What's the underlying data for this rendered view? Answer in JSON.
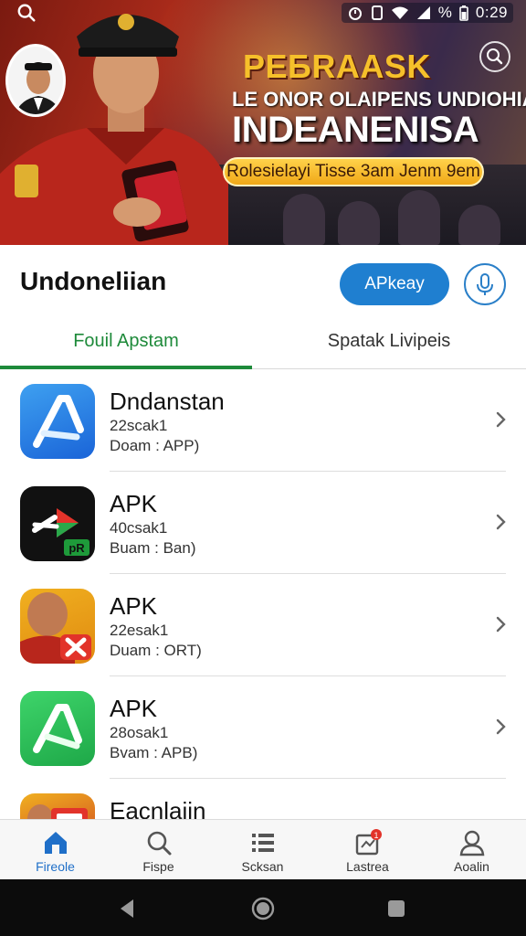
{
  "status_bar": {
    "time": "0:29",
    "battery": "%"
  },
  "banner": {
    "title": "PEБRAASK",
    "subtitle": "LE ONOR OLAIPENS UNDIOHIAN",
    "heading": "INDEANENISA",
    "pill_text": "Rolesielayi Tisse 3am Jenm 9em"
  },
  "header": {
    "title": "Undoneliian",
    "primary_button": "APkeay"
  },
  "tabs": [
    {
      "label": "Fouil Apstam"
    },
    {
      "label": "Spatak Livipeis"
    }
  ],
  "list": [
    {
      "name": "Dndanstan",
      "size": "22scak1",
      "meta": "Doam : APP)"
    },
    {
      "name": "APK",
      "size": "40csak1",
      "meta": "Buam : Ban)"
    },
    {
      "name": "APK",
      "size": "22esak1",
      "meta": "Duam : ORT)"
    },
    {
      "name": "APK",
      "size": "28osak1",
      "meta": "Bvam : APB)"
    },
    {
      "name": "Eacnlaiin",
      "size": "",
      "meta": ""
    }
  ],
  "bottom_nav": [
    {
      "label": "Fireole",
      "icon": "home-icon"
    },
    {
      "label": "Fispe",
      "icon": "search-icon"
    },
    {
      "label": "Scksan",
      "icon": "list-icon"
    },
    {
      "label": "Lastrea",
      "icon": "notification-icon",
      "badge": "1"
    },
    {
      "label": "Aoalin",
      "icon": "profile-icon"
    }
  ],
  "colors": {
    "accent": "#1e8a3a",
    "primary": "#1f7fd0",
    "banner_gold": "#f6c02a"
  }
}
